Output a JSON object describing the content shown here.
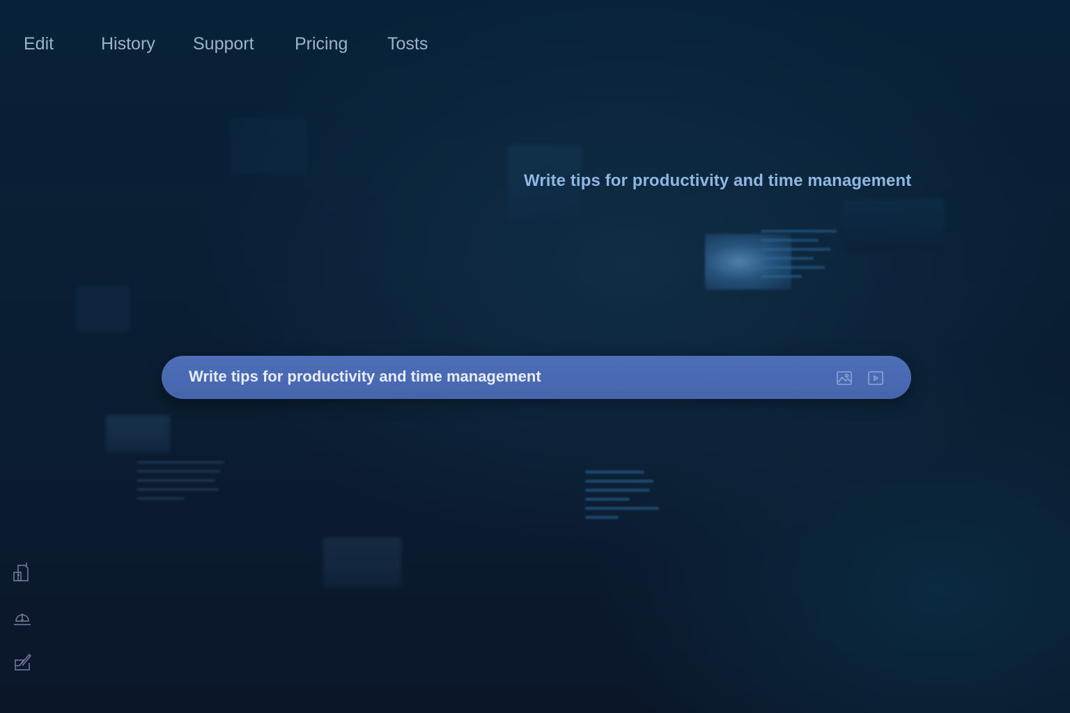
{
  "nav": {
    "items": [
      {
        "label": "Edit"
      },
      {
        "label": "History"
      },
      {
        "label": "Support"
      },
      {
        "label": "Pricing"
      },
      {
        "label": "Tosts"
      }
    ]
  },
  "headline": {
    "text": "Write tips for productivity and time management"
  },
  "prompt": {
    "text": "Write tips for productivity and time management",
    "actions": [
      {
        "icon": "image-icon"
      },
      {
        "icon": "video-icon"
      }
    ]
  },
  "sidebar": {
    "tools": [
      {
        "icon": "document-upload-icon"
      },
      {
        "icon": "alert-icon"
      },
      {
        "icon": "edit-icon"
      }
    ]
  },
  "colors": {
    "background": "#0a1e33",
    "nav_text": "#9db3c9",
    "headline": "#8fb7e2",
    "prompt_bar": "#4a6ab2",
    "prompt_text": "#e6ecf8",
    "rail_icon": "#7e7aa5"
  }
}
